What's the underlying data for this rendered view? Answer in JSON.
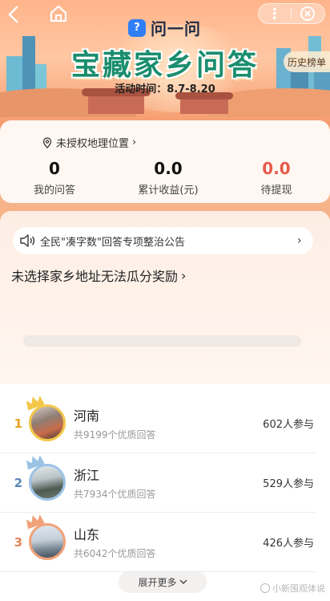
{
  "header": {
    "logo_mark": "?",
    "logo_text": "问一问",
    "title": "宝藏家乡问答",
    "activity_time": "活动时间：8.7-8.20",
    "history_button": "历史榜单",
    "more_icon": "⋮"
  },
  "stats": {
    "location": "未授权地理位置",
    "items": [
      {
        "value": "0",
        "label": "我的问答"
      },
      {
        "value": "0.0",
        "label": "累计收益(元)"
      },
      {
        "value": "0.0",
        "label": "待提现"
      }
    ]
  },
  "main": {
    "notice": "全民\"凑字数\"回答专项整治公告",
    "notice_arrow": "›",
    "warning": "未选择家乡地址无法瓜分奖励",
    "warning_arrow": "›"
  },
  "ranking": [
    {
      "rank": "1",
      "province": "河南",
      "answers": "共9199个优质回答",
      "participants": "602人参与",
      "rank_color": "#e8a21f",
      "crown_color": "#f3c74a"
    },
    {
      "rank": "2",
      "province": "浙江",
      "answers": "共7934个优质回答",
      "participants": "529人参与",
      "rank_color": "#5a86b8",
      "crown_color": "#9cc3e6"
    },
    {
      "rank": "3",
      "province": "山东",
      "answers": "共6042个优质回答",
      "participants": "426人参与",
      "rank_color": "#e2845a",
      "crown_color": "#f0a27a"
    }
  ],
  "expand_button": "展开更多",
  "watermark": "小新围观体说",
  "colors": {
    "accent": "#1a8e6f",
    "highlight": "#e75a4b"
  }
}
